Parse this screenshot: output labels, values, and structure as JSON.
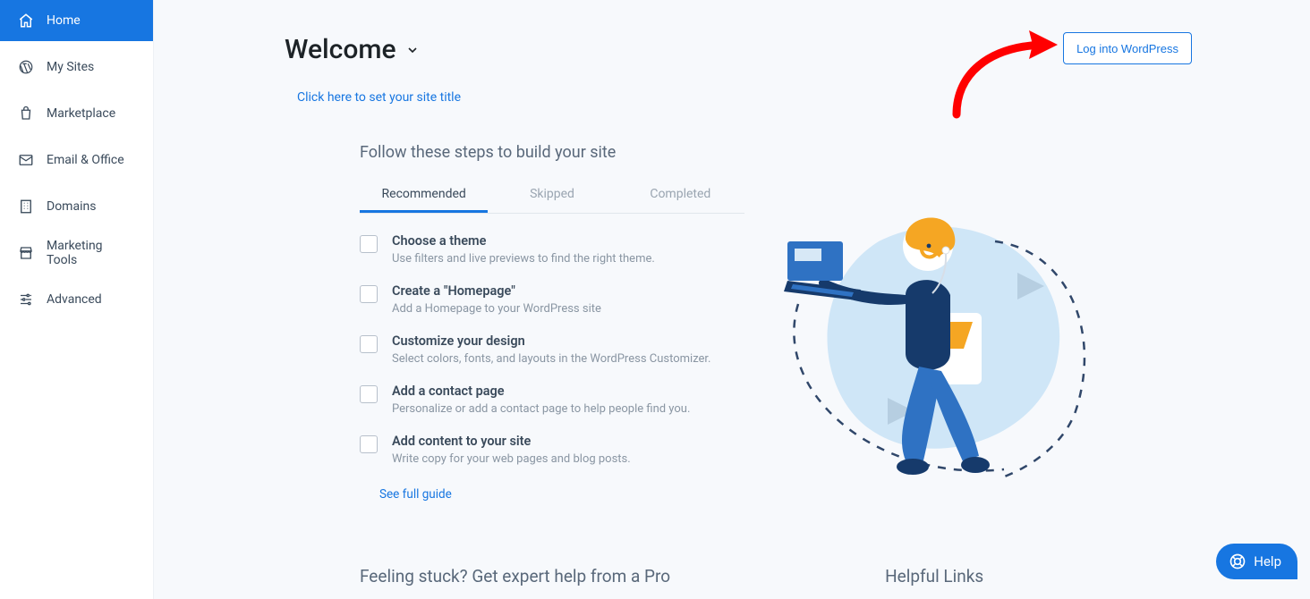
{
  "sidebar": {
    "items": [
      {
        "label": "Home"
      },
      {
        "label": "My Sites"
      },
      {
        "label": "Marketplace"
      },
      {
        "label": "Email & Office"
      },
      {
        "label": "Domains"
      },
      {
        "label": "Marketing Tools"
      },
      {
        "label": "Advanced"
      }
    ]
  },
  "header": {
    "welcome": "Welcome",
    "site_title_link": "Click here to set your site title",
    "login_button": "Log into WordPress"
  },
  "steps_card": {
    "heading": "Follow these steps to build your site",
    "tabs": {
      "recommended": "Recommended",
      "skipped": "Skipped",
      "completed": "Completed"
    },
    "steps": [
      {
        "title": "Choose a theme",
        "desc": "Use filters and live previews to find the right theme."
      },
      {
        "title": "Create a \"Homepage\"",
        "desc": "Add a Homepage to your WordPress site"
      },
      {
        "title": "Customize your design",
        "desc": "Select colors, fonts, and layouts in the WordPress Customizer."
      },
      {
        "title": "Add a contact page",
        "desc": "Personalize or add a contact page to help people find you."
      },
      {
        "title": "Add content to your site",
        "desc": "Write copy for your web pages and blog posts."
      }
    ],
    "see_guide": "See full guide"
  },
  "bottom": {
    "col1": "Feeling stuck? Get expert help from a Pro",
    "col2": "Helpful Links"
  },
  "help": {
    "label": "Help"
  }
}
